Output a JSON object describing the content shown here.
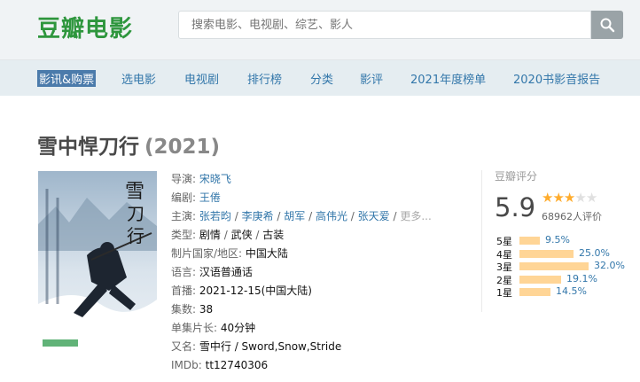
{
  "header": {
    "logo": "豆瓣电影",
    "search_placeholder": "搜索电影、电视剧、综艺、影人"
  },
  "nav": {
    "items": [
      "影讯&购票",
      "选电影",
      "电视剧",
      "排行榜",
      "分类",
      "影评",
      "2021年度榜单",
      "2020书影音报告"
    ]
  },
  "movie": {
    "title": "雪中悍刀行",
    "year": "(2021)",
    "poster_caption": "雪中悍刀行 poster"
  },
  "info": {
    "director_label": "导演:",
    "director": "宋晓飞",
    "writer_label": "编剧:",
    "writer": "王倦",
    "cast_label": "主演:",
    "cast": [
      "张若昀",
      "李庚希",
      "胡军",
      "高伟光",
      "张天爱"
    ],
    "cast_more": "更多...",
    "genre_label": "类型:",
    "genre": [
      "剧情",
      "武侠",
      "古装"
    ],
    "region_label": "制片国家/地区:",
    "region": "中国大陆",
    "language_label": "语言:",
    "language": "汉语普通话",
    "premiere_label": "首播:",
    "premiere": "2021-12-15(中国大陆)",
    "episodes_label": "集数:",
    "episodes": "38",
    "duration_label": "单集片长:",
    "duration": "40分钟",
    "aka_label": "又名:",
    "aka": "雪中行 / Sword,Snow,Stride",
    "imdb_label": "IMDb:",
    "imdb": "tt12740306"
  },
  "rating": {
    "label": "豆瓣评分",
    "score": "5.9",
    "stars_filled": 3,
    "stars_total": 5,
    "count": "68962人评价",
    "distribution": [
      {
        "label": "5星",
        "pct": "9.5%",
        "value": 9.5
      },
      {
        "label": "4星",
        "pct": "25.0%",
        "value": 25.0
      },
      {
        "label": "3星",
        "pct": "32.0%",
        "value": 32.0
      },
      {
        "label": "2星",
        "pct": "19.1%",
        "value": 19.1
      },
      {
        "label": "1星",
        "pct": "14.5%",
        "value": 14.5
      }
    ]
  },
  "colors": {
    "brand": "#2e963d",
    "link": "#3377aa",
    "star": "#ffac2d",
    "bar": "#ffd596"
  }
}
